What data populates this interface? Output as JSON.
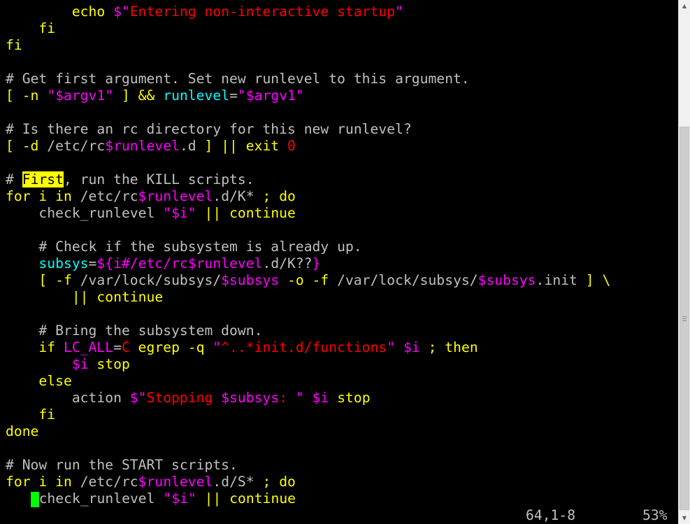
{
  "colors": {
    "background": "#000000",
    "default": "#c0c0c0",
    "keyword": "#ffff00",
    "string": "#ff0000",
    "variable": "#ff00ff",
    "comment": "#c0c0c0",
    "identifier": "#00ffff",
    "cursor": "#00ff00",
    "search_highlight": "#ffff00"
  },
  "editor": {
    "lines": [
      [
        {
          "t": "        ",
          "c": "default"
        },
        {
          "t": "echo",
          "c": "keyword"
        },
        {
          "t": " ",
          "c": "default"
        },
        {
          "t": "$\"",
          "c": "variable"
        },
        {
          "t": "Entering non-interactive startup",
          "c": "string"
        },
        {
          "t": "\"",
          "c": "variable"
        }
      ],
      [
        {
          "t": "    ",
          "c": "default"
        },
        {
          "t": "fi",
          "c": "keyword"
        }
      ],
      [
        {
          "t": "fi",
          "c": "keyword"
        }
      ],
      [],
      [
        {
          "t": "# Get first argument. Set new runlevel to this argument.",
          "c": "comment"
        }
      ],
      [
        {
          "t": "[ -n ",
          "c": "keyword"
        },
        {
          "t": "\"",
          "c": "variable"
        },
        {
          "t": "$argv1",
          "c": "variable"
        },
        {
          "t": "\"",
          "c": "variable"
        },
        {
          "t": " ] && ",
          "c": "keyword"
        },
        {
          "t": "runlevel",
          "c": "identifier"
        },
        {
          "t": "=",
          "c": "default"
        },
        {
          "t": "\"",
          "c": "variable"
        },
        {
          "t": "$argv1",
          "c": "variable"
        },
        {
          "t": "\"",
          "c": "variable"
        }
      ],
      [],
      [
        {
          "t": "# Is there an rc directory for this new runlevel?",
          "c": "comment"
        }
      ],
      [
        {
          "t": "[ -d ",
          "c": "keyword"
        },
        {
          "t": "/etc/rc",
          "c": "default"
        },
        {
          "t": "$runlevel",
          "c": "variable"
        },
        {
          "t": ".d ",
          "c": "default"
        },
        {
          "t": "] || exit ",
          "c": "keyword"
        },
        {
          "t": "0",
          "c": "string"
        }
      ],
      [],
      [
        {
          "t": "# ",
          "c": "comment"
        },
        {
          "t": "First",
          "c": "comment",
          "hl": true
        },
        {
          "t": ", run the KILL scripts.",
          "c": "comment"
        }
      ],
      [
        {
          "t": "for i in ",
          "c": "keyword"
        },
        {
          "t": "/etc/rc",
          "c": "default"
        },
        {
          "t": "$runlevel",
          "c": "variable"
        },
        {
          "t": ".d/K* ",
          "c": "default"
        },
        {
          "t": "; do",
          "c": "keyword"
        }
      ],
      [
        {
          "t": "    check_runlevel ",
          "c": "default"
        },
        {
          "t": "\"",
          "c": "variable"
        },
        {
          "t": "$i",
          "c": "variable"
        },
        {
          "t": "\"",
          "c": "variable"
        },
        {
          "t": " || continue",
          "c": "keyword"
        }
      ],
      [],
      [
        {
          "t": "    # Check if the subsystem is already up.",
          "c": "comment"
        }
      ],
      [
        {
          "t": "    ",
          "c": "default"
        },
        {
          "t": "subsys",
          "c": "identifier"
        },
        {
          "t": "=",
          "c": "default"
        },
        {
          "t": "${",
          "c": "variable"
        },
        {
          "t": "i#/etc/rc",
          "c": "variable"
        },
        {
          "t": "$runlevel",
          "c": "variable"
        },
        {
          "t": ".d/K??",
          "c": "default"
        },
        {
          "t": "}",
          "c": "variable"
        }
      ],
      [
        {
          "t": "    [ -f ",
          "c": "keyword"
        },
        {
          "t": "/var/lock/subsys/",
          "c": "default"
        },
        {
          "t": "$subsys",
          "c": "variable"
        },
        {
          "t": " -o -f ",
          "c": "keyword"
        },
        {
          "t": "/var/lock/subsys/",
          "c": "default"
        },
        {
          "t": "$subsys",
          "c": "variable"
        },
        {
          "t": ".init ",
          "c": "default"
        },
        {
          "t": "] \\",
          "c": "keyword"
        }
      ],
      [
        {
          "t": "        || continue",
          "c": "keyword"
        }
      ],
      [],
      [
        {
          "t": "    # Bring the subsystem down.",
          "c": "comment"
        }
      ],
      [
        {
          "t": "    if ",
          "c": "keyword"
        },
        {
          "t": "LC_ALL",
          "c": "variable"
        },
        {
          "t": "=",
          "c": "default"
        },
        {
          "t": "C",
          "c": "string"
        },
        {
          "t": " egrep -q ",
          "c": "keyword"
        },
        {
          "t": "\"",
          "c": "variable"
        },
        {
          "t": "^..*init.d/functions",
          "c": "string"
        },
        {
          "t": "\"",
          "c": "variable"
        },
        {
          "t": " ",
          "c": "default"
        },
        {
          "t": "$i",
          "c": "variable"
        },
        {
          "t": " ; then",
          "c": "keyword"
        }
      ],
      [
        {
          "t": "        ",
          "c": "default"
        },
        {
          "t": "$i",
          "c": "variable"
        },
        {
          "t": " stop",
          "c": "keyword"
        }
      ],
      [
        {
          "t": "    else",
          "c": "keyword"
        }
      ],
      [
        {
          "t": "        action ",
          "c": "default"
        },
        {
          "t": "$\"",
          "c": "variable"
        },
        {
          "t": "Stopping ",
          "c": "string"
        },
        {
          "t": "$subsys",
          "c": "variable"
        },
        {
          "t": ": ",
          "c": "string"
        },
        {
          "t": "\"",
          "c": "variable"
        },
        {
          "t": " ",
          "c": "default"
        },
        {
          "t": "$i",
          "c": "variable"
        },
        {
          "t": " stop",
          "c": "keyword"
        }
      ],
      [
        {
          "t": "    fi",
          "c": "keyword"
        }
      ],
      [
        {
          "t": "done",
          "c": "keyword"
        }
      ],
      [],
      [
        {
          "t": "# Now run the START scripts.",
          "c": "comment"
        }
      ],
      [
        {
          "t": "for i in ",
          "c": "keyword"
        },
        {
          "t": "/etc/rc",
          "c": "default"
        },
        {
          "t": "$runlevel",
          "c": "variable"
        },
        {
          "t": ".d/S* ",
          "c": "default"
        },
        {
          "t": "; do",
          "c": "keyword"
        }
      ],
      [
        {
          "t": "   ",
          "c": "default"
        },
        {
          "t": "",
          "c": "default",
          "cursor": true
        },
        {
          "t": "check_runlevel ",
          "c": "default"
        },
        {
          "t": "\"",
          "c": "variable"
        },
        {
          "t": "$i",
          "c": "variable"
        },
        {
          "t": "\"",
          "c": "variable"
        },
        {
          "t": " || continue",
          "c": "keyword"
        }
      ]
    ]
  },
  "status": {
    "position": "64,1-8",
    "percent": "53%"
  },
  "scrollbar": {
    "position": 0.53,
    "up_icon": "triangle-up-icon",
    "down_icon": "triangle-down-icon"
  }
}
